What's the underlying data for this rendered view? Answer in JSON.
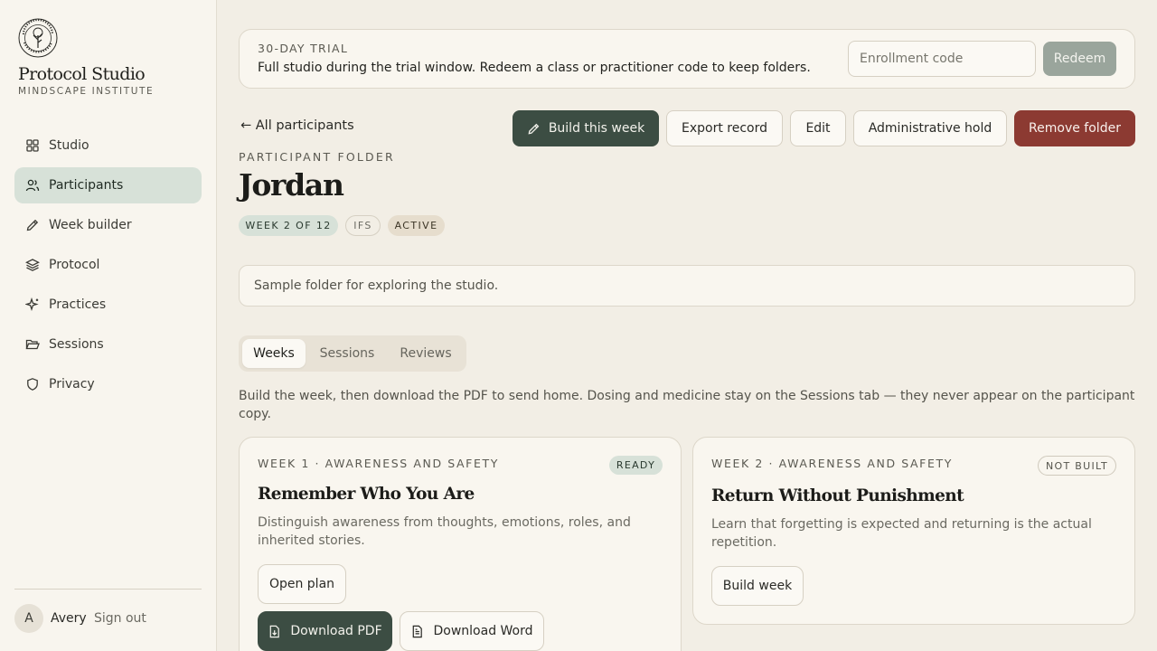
{
  "sidebar": {
    "logo_icon": "mindscape-tree-seal",
    "brand_title": "Protocol Studio",
    "brand_subtitle": "MINDSCAPE INSTITUTE",
    "items": [
      {
        "label": "Studio",
        "icon": "grid-icon",
        "active": false
      },
      {
        "label": "Participants",
        "icon": "users-icon",
        "active": true
      },
      {
        "label": "Week builder",
        "icon": "pencil-icon",
        "active": false
      },
      {
        "label": "Protocol",
        "icon": "layers-icon",
        "active": false
      },
      {
        "label": "Practices",
        "icon": "sparkle-icon",
        "active": false
      },
      {
        "label": "Sessions",
        "icon": "folder-open-icon",
        "active": false
      },
      {
        "label": "Privacy",
        "icon": "shield-icon",
        "active": false
      }
    ],
    "user": {
      "initial": "A",
      "name": "Avery",
      "signout": "Sign out"
    }
  },
  "trial": {
    "kicker": "30-DAY TRIAL",
    "text": "Full studio during the trial window. Redeem a class or practitioner code to keep folders.",
    "input_placeholder": "Enrollment code",
    "input_value": "",
    "redeem_label": "Redeem"
  },
  "header": {
    "back_label": "← All participants",
    "actions": {
      "build": "Build this week",
      "export": "Export record",
      "edit": "Edit",
      "hold": "Administrative hold",
      "remove": "Remove folder"
    },
    "kicker": "PARTICIPANT FOLDER",
    "name": "Jordan",
    "badges": {
      "week": "WEEK 2 OF 12",
      "modality": "IFS",
      "status": "ACTIVE"
    }
  },
  "notes": "Sample folder for exploring the studio.",
  "tabs": [
    {
      "label": "Weeks",
      "active": true
    },
    {
      "label": "Sessions",
      "active": false
    },
    {
      "label": "Reviews",
      "active": false
    }
  ],
  "hint": "Build the week, then download the PDF to send home. Dosing and medicine stay on the Sessions tab — they never appear on the participant copy.",
  "weeks": [
    {
      "kicker": "WEEK 1 · AWARENESS AND SAFETY",
      "status": "READY",
      "title": "Remember Who You Are",
      "description": "Distinguish awareness from thoughts, emotions, roles, and inherited stories.",
      "open_plan": "Open plan",
      "download_pdf": "Download PDF",
      "download_word": "Download Word"
    },
    {
      "kicker": "WEEK 2 · AWARENESS AND SAFETY",
      "status": "NOT BUILT",
      "title": "Return Without Punishment",
      "description": "Learn that forgetting is expected and returning is the actual repetition.",
      "build_week": "Build week"
    }
  ],
  "colors": {
    "accent_dark_green": "#3c4d43",
    "danger": "#8c3a32",
    "active_nav": "#d7e1d8",
    "background": "#f2eee5"
  }
}
